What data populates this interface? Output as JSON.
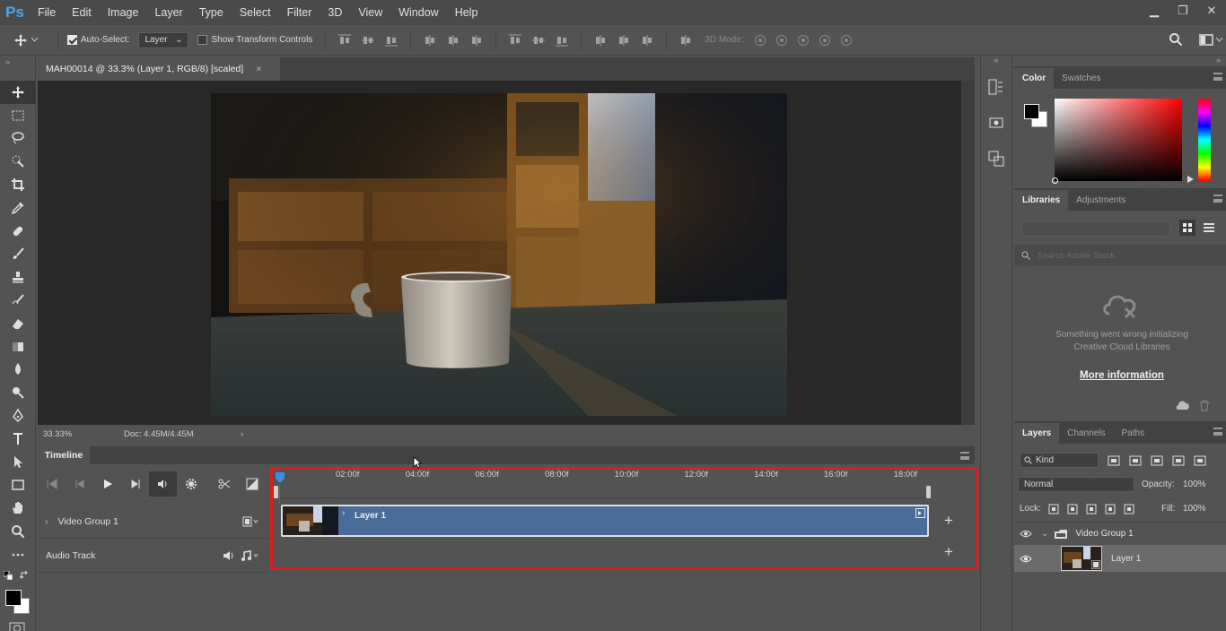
{
  "app": {
    "logo": "Ps"
  },
  "menu": [
    "File",
    "Edit",
    "Image",
    "Layer",
    "Type",
    "Select",
    "Filter",
    "3D",
    "View",
    "Window",
    "Help"
  ],
  "window_controls": {
    "minimize": "▁",
    "restore": "❐",
    "close": "✕"
  },
  "options_bar": {
    "auto_select_label": "Auto-Select:",
    "auto_select_checked": true,
    "layer_select": "Layer",
    "transform_controls_label": "Show Transform Controls",
    "transform_controls_checked": false,
    "mode_3d_label": "3D Mode:"
  },
  "document": {
    "tab_title": "MAH00014 @ 33.3% (Layer 1, RGB/8) [scaled]",
    "close": "×",
    "zoom": "33.33%",
    "doc_size": "Doc: 4.45M/4.45M",
    "status_arrow": "›"
  },
  "timeline": {
    "tab_label": "Timeline",
    "ruler_ticks": [
      "02:00f",
      "04:00f",
      "06:00f",
      "08:00f",
      "10:00f",
      "12:00f",
      "14:00f",
      "16:00f",
      "18:00f"
    ],
    "tracks": [
      {
        "name": "Video Group 1",
        "type": "video"
      },
      {
        "name": "Audio Track",
        "type": "audio"
      }
    ],
    "clip_label": "Layer 1",
    "add": "+"
  },
  "color_panel": {
    "tabs": [
      "Color",
      "Swatches"
    ],
    "active": "Color",
    "fg": "#000000",
    "bg": "#ffffff"
  },
  "libraries_panel": {
    "tabs": [
      "Libraries",
      "Adjustments"
    ],
    "active": "Libraries",
    "search_placeholder": "Search Adobe Stock",
    "error_line1": "Something went wrong initializing",
    "error_line2": "Creative Cloud Libraries",
    "more_info": "More information"
  },
  "layers_panel": {
    "tabs": [
      "Layers",
      "Channels",
      "Paths"
    ],
    "active": "Layers",
    "kind_label": "Kind",
    "blend_mode": "Normal",
    "opacity_label": "Opacity:",
    "opacity": "100%",
    "lock_label": "Lock:",
    "fill_label": "Fill:",
    "fill": "100%",
    "layers": [
      {
        "name": "Video Group 1",
        "type": "group"
      },
      {
        "name": "Layer 1",
        "type": "layer",
        "selected": true
      }
    ]
  },
  "colors": {
    "accent": "#4aa8f0",
    "highlight_box": "#e11b22",
    "clip": "#4b6b98"
  }
}
